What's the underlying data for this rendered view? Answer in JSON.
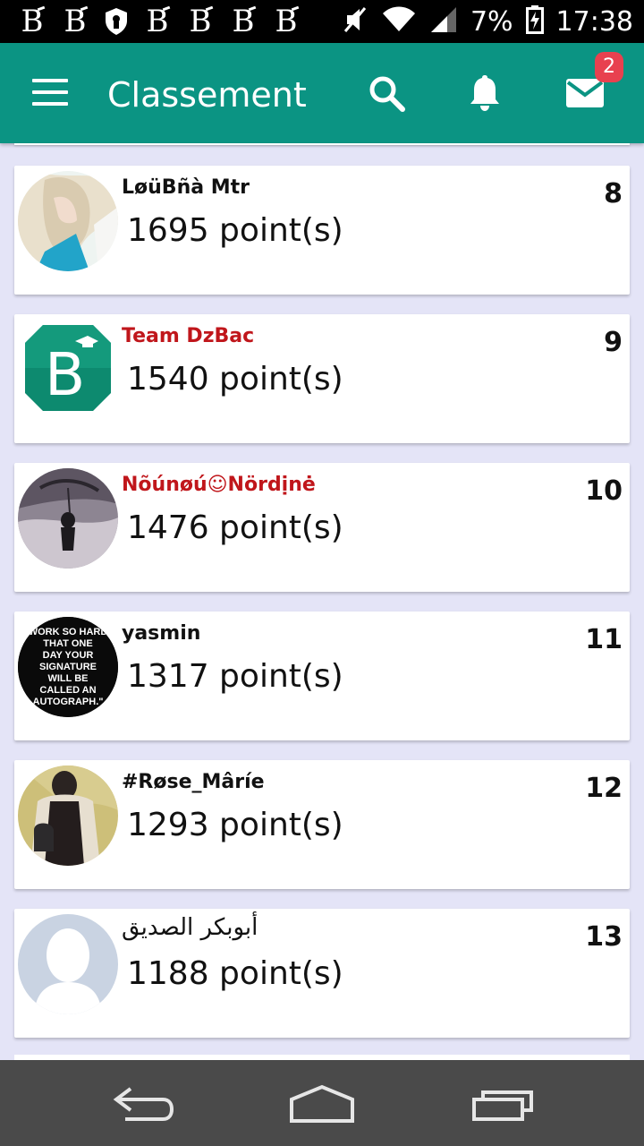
{
  "status_bar": {
    "battery": "7%",
    "time": "17:38",
    "notification_icons": [
      "b-app-icon",
      "b-app-icon",
      "shield-icon",
      "b-app-icon",
      "b-app-icon",
      "b-app-icon",
      "b-app-icon"
    ]
  },
  "appbar": {
    "title": "Classement",
    "mail_badge": "2"
  },
  "colors": {
    "primary": "#0b9483",
    "background": "#e4e4f7",
    "badge": "#e8414f",
    "name_red": "#c0161b"
  },
  "entries": [
    {
      "name": "LøüBñà Mtr",
      "points": "1695 point(s)",
      "rank": "8",
      "name_color": "black",
      "avatar": "photo-avatar"
    },
    {
      "name": "Team DzBac",
      "points": "1540 point(s)",
      "rank": "9",
      "name_color": "red",
      "avatar": "dzbac-logo"
    },
    {
      "name": "Nõúnøú☺Nördịnė",
      "points": "1476 point(s)",
      "rank": "10",
      "name_color": "red",
      "avatar": "photo-avatar"
    },
    {
      "name": "yasmin",
      "points": "1317 point(s)",
      "rank": "11",
      "name_color": "black",
      "avatar": "quote-avatar"
    },
    {
      "name": "#Røse_Mâríe",
      "points": "1293 point(s)",
      "rank": "12",
      "name_color": "black",
      "avatar": "photo-avatar"
    },
    {
      "name": "أبوبكر الصديق",
      "points": "1188 point(s)",
      "rank": "13",
      "name_color": "black",
      "avatar": "default-avatar"
    }
  ],
  "quote_avatar_text": [
    "WORK SO HARD",
    "THAT ONE",
    "DAY YOUR",
    "SIGNATURE",
    "WILL BE",
    "CALLED AN",
    "AUTOGRAPH.\""
  ],
  "navigation": [
    "back-button",
    "home-button",
    "recents-button"
  ]
}
